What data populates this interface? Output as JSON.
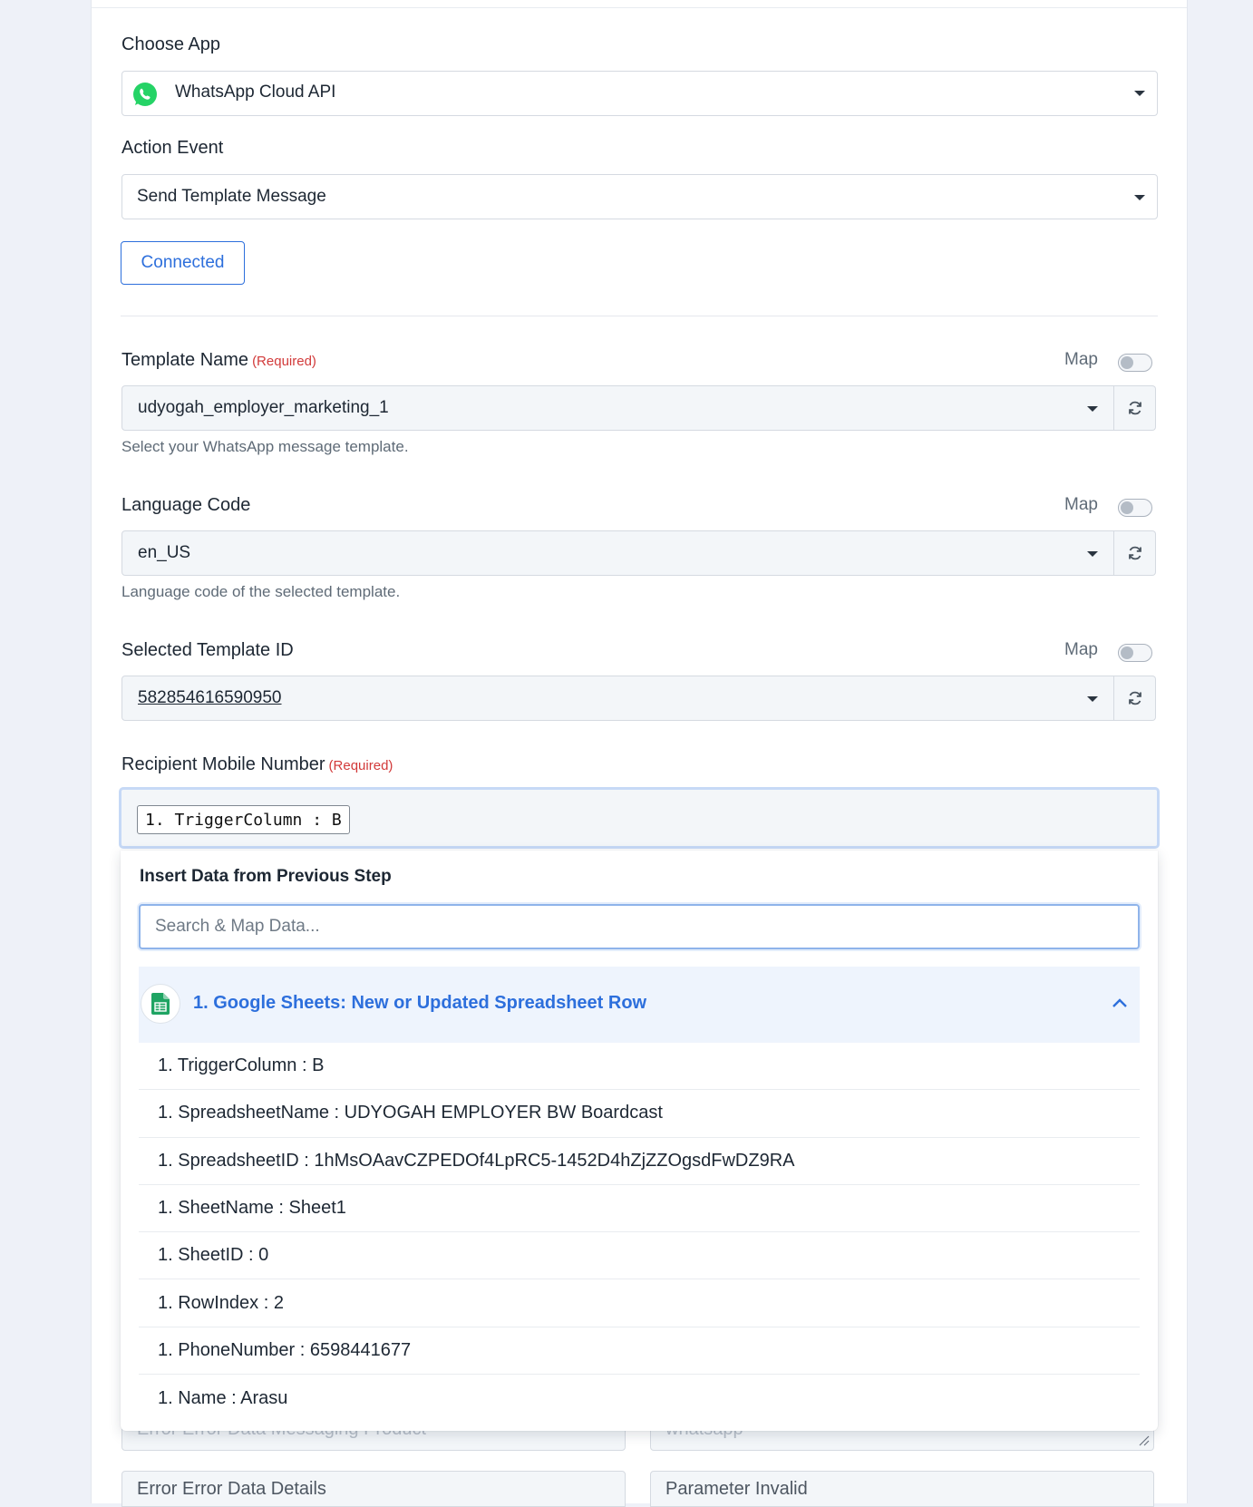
{
  "choose_app": {
    "label": "Choose App",
    "selected": "WhatsApp Cloud API",
    "icon": "whatsapp-icon"
  },
  "action_event": {
    "label": "Action Event",
    "selected": "Send Template Message"
  },
  "connection": {
    "button_label": "Connected"
  },
  "fields": {
    "template_name": {
      "label": "Template Name",
      "required": "(Required)",
      "map_label": "Map",
      "value": "udyogah_employer_marketing_1",
      "help": "Select your WhatsApp message template."
    },
    "language_code": {
      "label": "Language Code",
      "map_label": "Map",
      "value": "en_US",
      "help": "Language code of the selected template."
    },
    "template_id": {
      "label": "Selected Template ID",
      "map_label": "Map",
      "value": "582854616590950"
    },
    "recipient": {
      "label": "Recipient Mobile Number",
      "required": "(Required)",
      "chip": "1. TriggerColumn : B"
    }
  },
  "dropdown": {
    "title": "Insert Data from Previous Step",
    "search_placeholder": "Search & Map Data...",
    "group_label": "1. Google Sheets: New or Updated Spreadsheet Row",
    "items": [
      "1. TriggerColumn : B",
      "1. SpreadsheetName : UDYOGAH EMPLOYER BW Boardcast",
      "1. SpreadsheetID : 1hMsOAavCZPEDOf4LpRC5-1452D4hZjZZOgsdFwDZ9RA",
      "1. SheetName : Sheet1",
      "1. SheetID : 0",
      "1. RowIndex : 2",
      "1. PhoneNumber : 6598441677",
      "1. Name : Arasu"
    ]
  },
  "bottom": {
    "left_partial": "Error Error Data Messaging Product",
    "right_partial": "whatsapp",
    "left_field": "Error Error Data Details",
    "right_field": "Parameter Invalid"
  },
  "colors": {
    "accent": "#2d6fdc",
    "required": "#d23a3a",
    "whatsapp": "#25d366",
    "sheets": "#1fa463"
  }
}
